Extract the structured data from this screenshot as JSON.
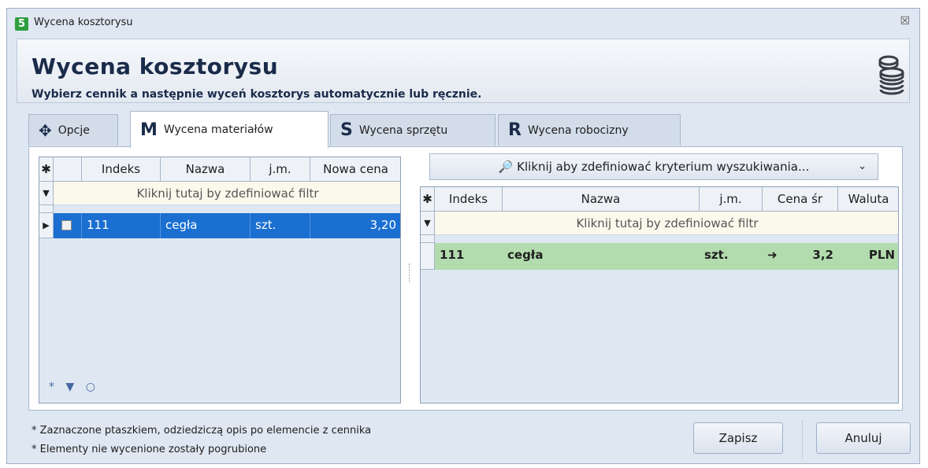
{
  "window": {
    "title": "Wycena kosztorysu",
    "close_glyph": "☒",
    "icon_text": "5"
  },
  "header": {
    "title": "Wycena kosztorysu",
    "subtitle": "Wybierz cennik a następnie wyceń kosztorys automatycznie lub ręcznie.",
    "icon": "coins-icon"
  },
  "tabs": [
    {
      "label": "Opcje",
      "icon": "gear-icon",
      "glyph": "✥"
    },
    {
      "label": "Wycena materiałów",
      "icon": "m-icon",
      "glyph": "M",
      "active": true
    },
    {
      "label": "Wycena sprzętu",
      "icon": "s-icon",
      "glyph": "S"
    },
    {
      "label": "Wycena robocizny",
      "icon": "r-icon",
      "glyph": "R"
    }
  ],
  "left_grid": {
    "columns": [
      "Indeks",
      "Nazwa",
      "j.m.",
      "Nowa cena"
    ],
    "filter_text": "Kliknij tutaj by zdefiniować filtr",
    "rows": [
      {
        "indeks": "111",
        "nazwa": "cegła",
        "jm": "szt.",
        "nowa_cena": "3,20"
      }
    ],
    "nav_icons": [
      "*",
      "▼",
      "○"
    ]
  },
  "right_grid": {
    "search_label": "🔎 Kliknij aby zdefiniować kryterium wyszukiwania...",
    "columns": [
      "Indeks",
      "Nazwa",
      "j.m.",
      "Cena śr",
      "Waluta"
    ],
    "filter_text": "Kliknij tutaj by zdefiniować filtr",
    "rows": [
      {
        "indeks": "111",
        "nazwa": "cegła",
        "jm": "szt.",
        "arrow": "➜",
        "cena_sr": "3,2",
        "waluta": "PLN"
      }
    ]
  },
  "notes": [
    "* Zaznaczone ptaszkiem,  odziedziczą opis po elemencie z cennika",
    "* Elementy nie wycenione zostały pogrubione"
  ],
  "buttons": {
    "save": "Zapisz",
    "cancel": "Anuluj"
  },
  "colors": {
    "accent": "#1a6fd1",
    "row_green": "#b3dcae",
    "filter_bg": "#fbf8ec"
  }
}
